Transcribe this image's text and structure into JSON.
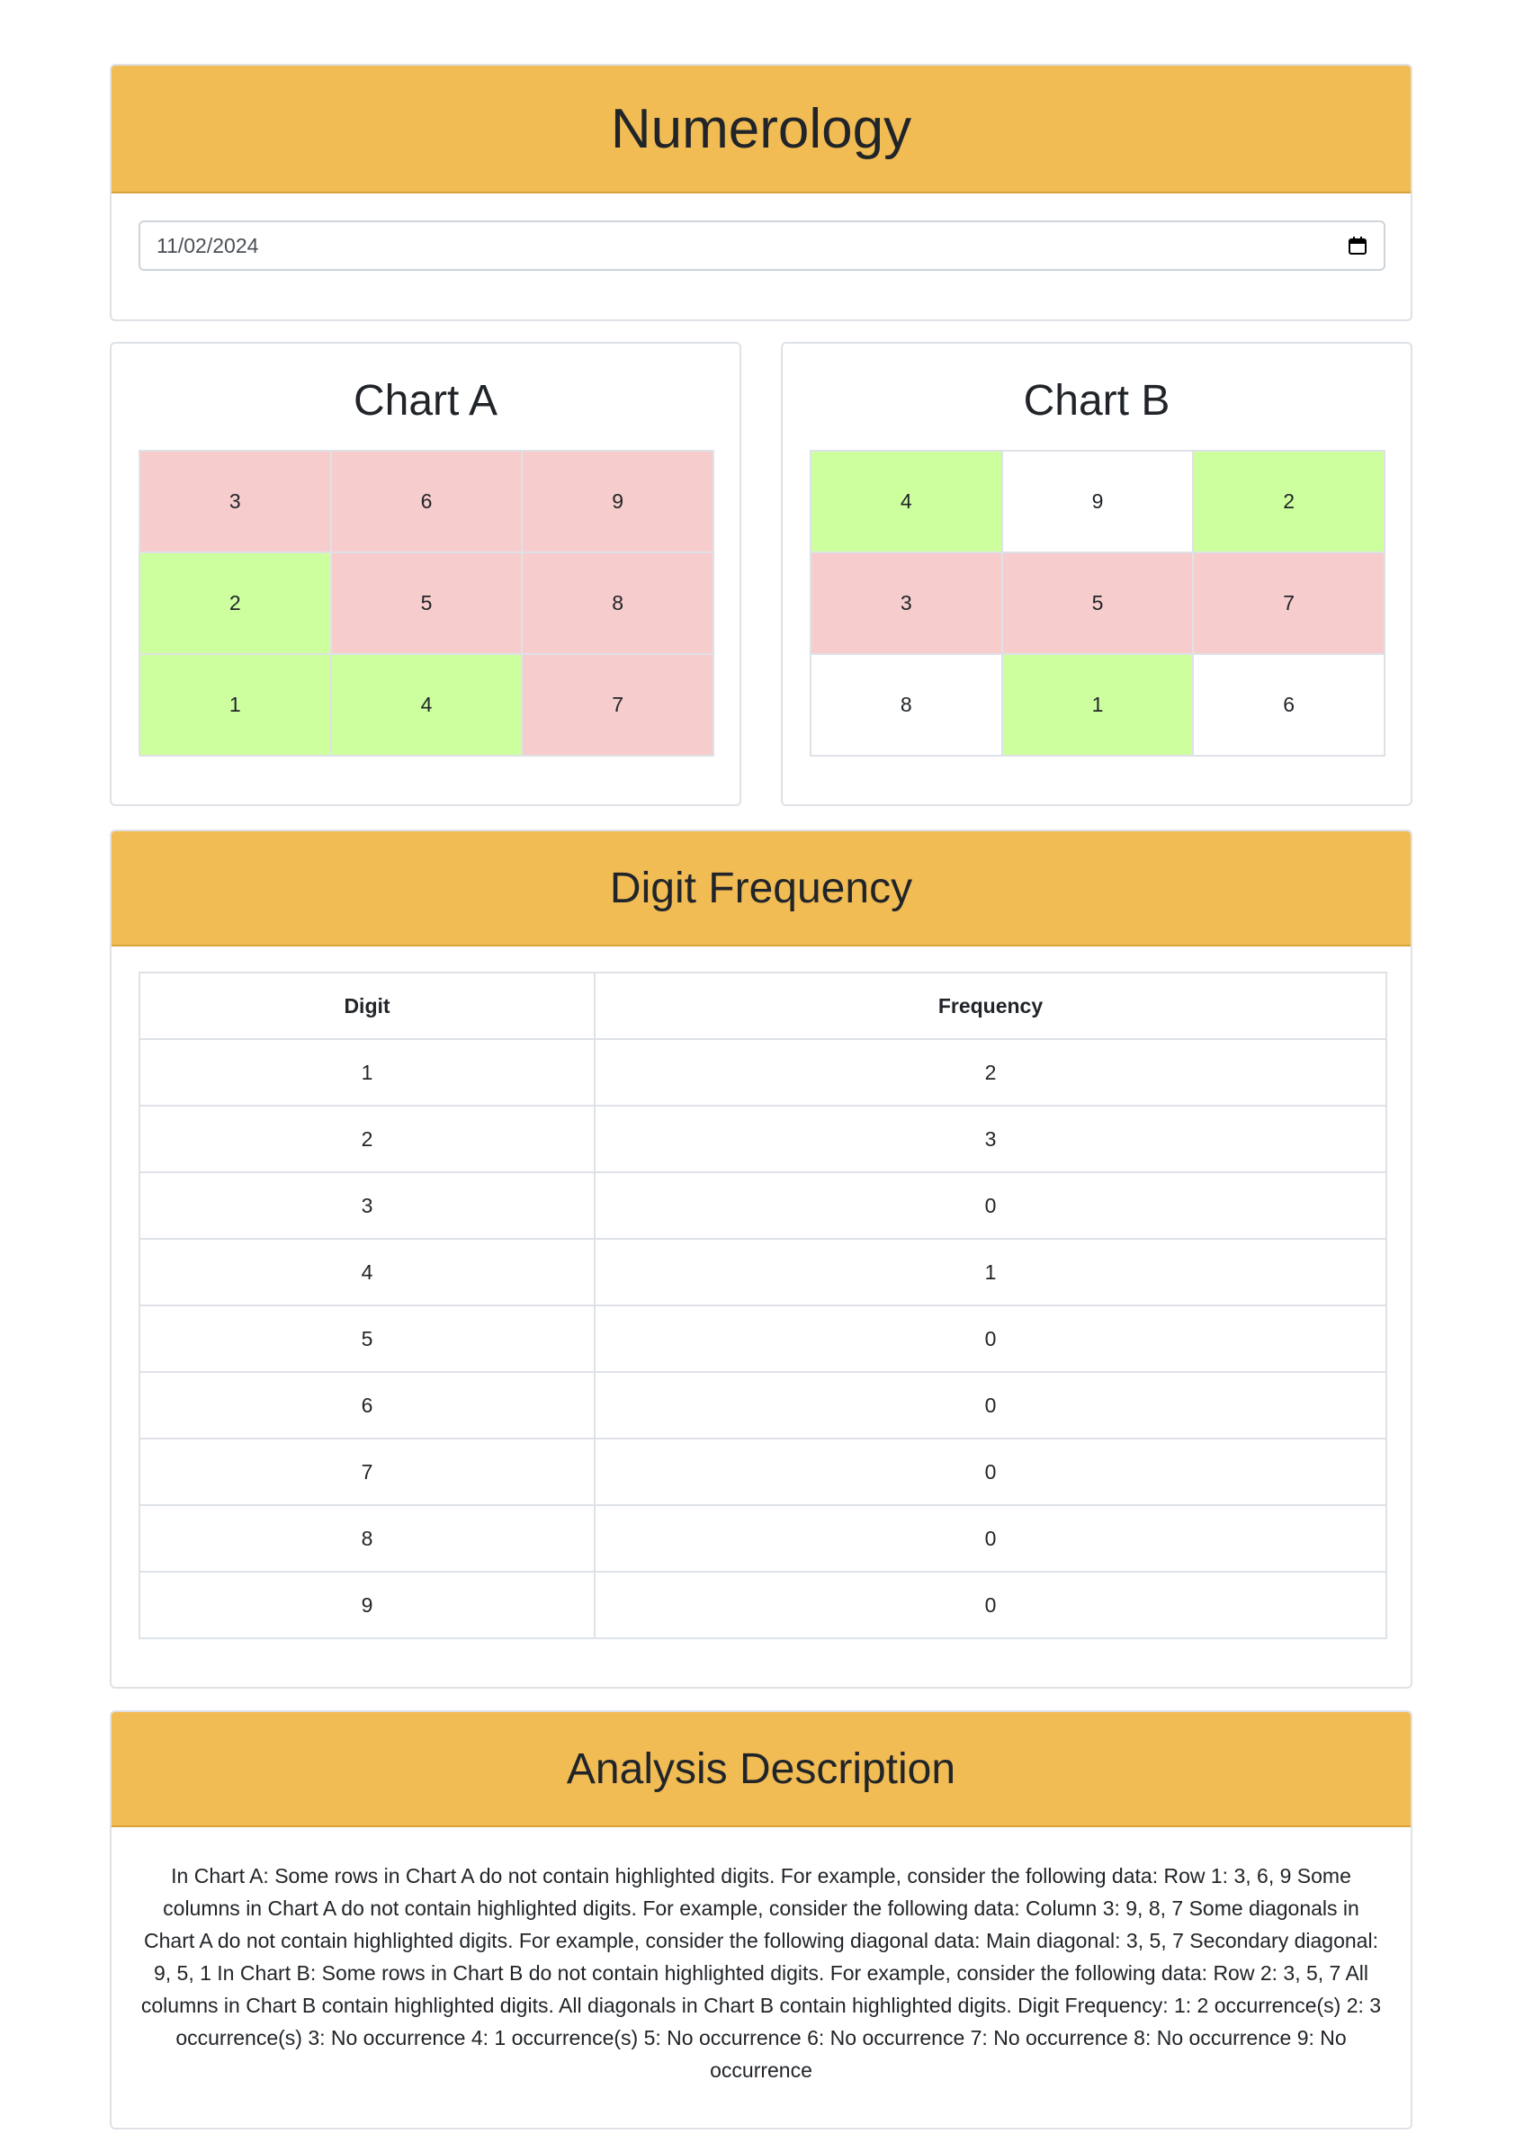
{
  "header": {
    "title": "Numerology"
  },
  "date_input": {
    "value": "11/02/2024",
    "icon": "calendar-icon"
  },
  "chart_a": {
    "title": "Chart A",
    "rows": [
      [
        {
          "v": "3",
          "c": "#f7cccc"
        },
        {
          "v": "6",
          "c": "#f7cccc"
        },
        {
          "v": "9",
          "c": "#f7cccc"
        }
      ],
      [
        {
          "v": "2",
          "c": "#ceff9f"
        },
        {
          "v": "5",
          "c": "#f7cccc"
        },
        {
          "v": "8",
          "c": "#f7cccc"
        }
      ],
      [
        {
          "v": "1",
          "c": "#ceff9f"
        },
        {
          "v": "4",
          "c": "#ceff9f"
        },
        {
          "v": "7",
          "c": "#f7cccc"
        }
      ]
    ]
  },
  "chart_b": {
    "title": "Chart B",
    "rows": [
      [
        {
          "v": "4",
          "c": "#ceff9f"
        },
        {
          "v": "9",
          "c": "#ffffff"
        },
        {
          "v": "2",
          "c": "#ceff9f"
        }
      ],
      [
        {
          "v": "3",
          "c": "#f7cccc"
        },
        {
          "v": "5",
          "c": "#f7cccc"
        },
        {
          "v": "7",
          "c": "#f7cccc"
        }
      ],
      [
        {
          "v": "8",
          "c": "#ffffff"
        },
        {
          "v": "1",
          "c": "#ceff9f"
        },
        {
          "v": "6",
          "c": "#ffffff"
        }
      ]
    ]
  },
  "frequency": {
    "title": "Digit Frequency",
    "columns": [
      "Digit",
      "Frequency"
    ],
    "rows": [
      [
        "1",
        "2"
      ],
      [
        "2",
        "3"
      ],
      [
        "3",
        "0"
      ],
      [
        "4",
        "1"
      ],
      [
        "5",
        "0"
      ],
      [
        "6",
        "0"
      ],
      [
        "7",
        "0"
      ],
      [
        "8",
        "0"
      ],
      [
        "9",
        "0"
      ]
    ]
  },
  "analysis": {
    "title": "Analysis Description",
    "text": "In Chart A: Some rows in Chart A do not contain highlighted digits. For example, consider the following data: Row 1: 3, 6, 9 Some columns in Chart A do not contain highlighted digits. For example, consider the following data: Column 3: 9, 8, 7 Some diagonals in Chart A do not contain highlighted digits. For example, consider the following diagonal data: Main diagonal: 3, 5, 7 Secondary diagonal: 9, 5, 1 In Chart B: Some rows in Chart B do not contain highlighted digits. For example, consider the following data: Row 2: 3, 5, 7 All columns in Chart B contain highlighted digits. All diagonals in Chart B contain highlighted digits. Digit Frequency: 1: 2 occurrence(s) 2: 3 occurrence(s) 3: No occurrence 4: 1 occurrence(s) 5: No occurrence 6: No occurrence 7: No occurrence 8: No occurrence 9: No occurrence"
  }
}
